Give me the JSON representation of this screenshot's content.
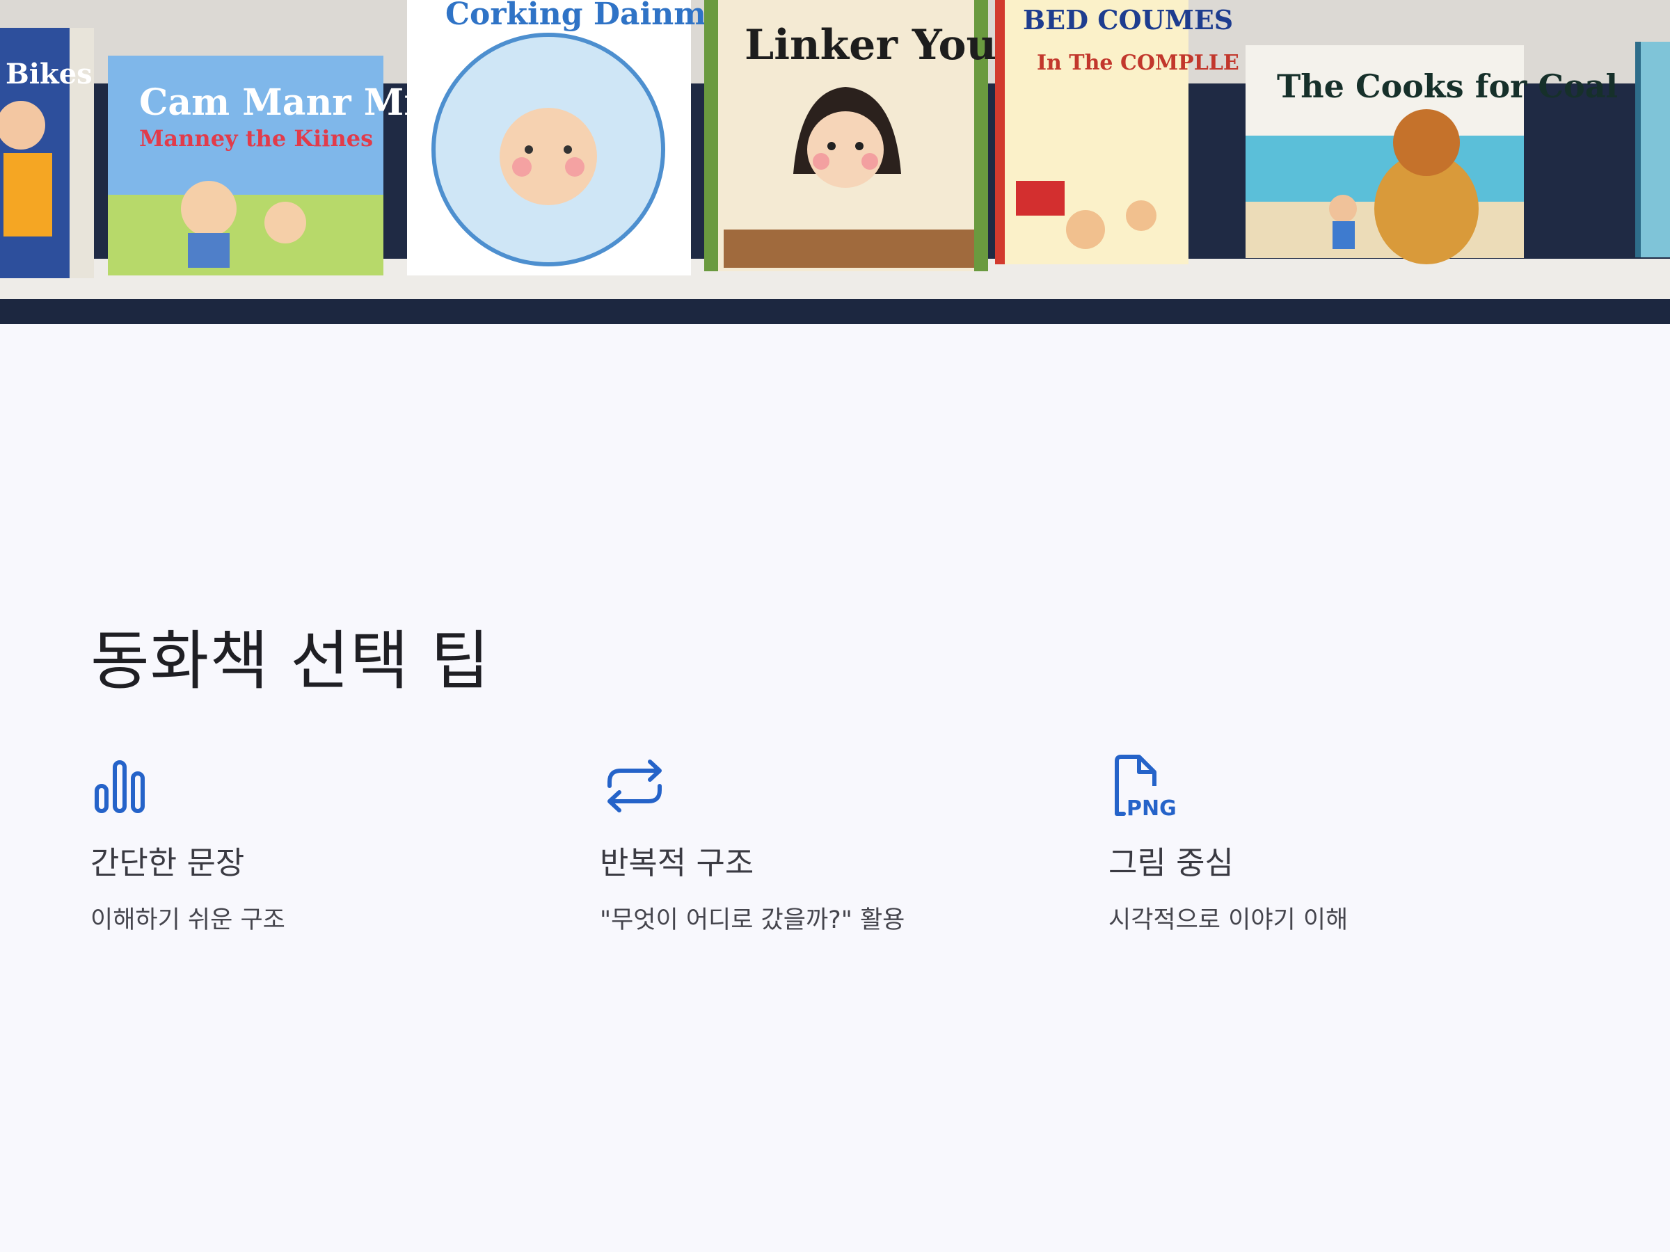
{
  "hero": {
    "books": [
      {
        "title": "Bikes"
      },
      {
        "title": "Cam Manr Miney",
        "subtitle": "Manney the Kiines"
      },
      {
        "title": "Corking Dainmes"
      },
      {
        "title": "Linker You!"
      },
      {
        "title": "BED COUMES",
        "subtitle": "In The COMPLLE CITNER"
      },
      {
        "title": "The Cooks for Coal"
      }
    ]
  },
  "page": {
    "title": "동화책 선택 팁"
  },
  "tips": [
    {
      "icon": "bar-chart-icon",
      "title": "간단한 문장",
      "description": "이해하기 쉬운 구조"
    },
    {
      "icon": "repeat-icon",
      "title": "반복적 구조",
      "description": "\"무엇이 어디로 갔을까?\" 활용"
    },
    {
      "icon": "png-file-icon",
      "title": "그림 중심",
      "description": "시각적으로 이야기 이해"
    }
  ],
  "colors": {
    "accent": "#2563c9",
    "background": "#f8f8fd",
    "shelf_dark": "#1c2740"
  }
}
